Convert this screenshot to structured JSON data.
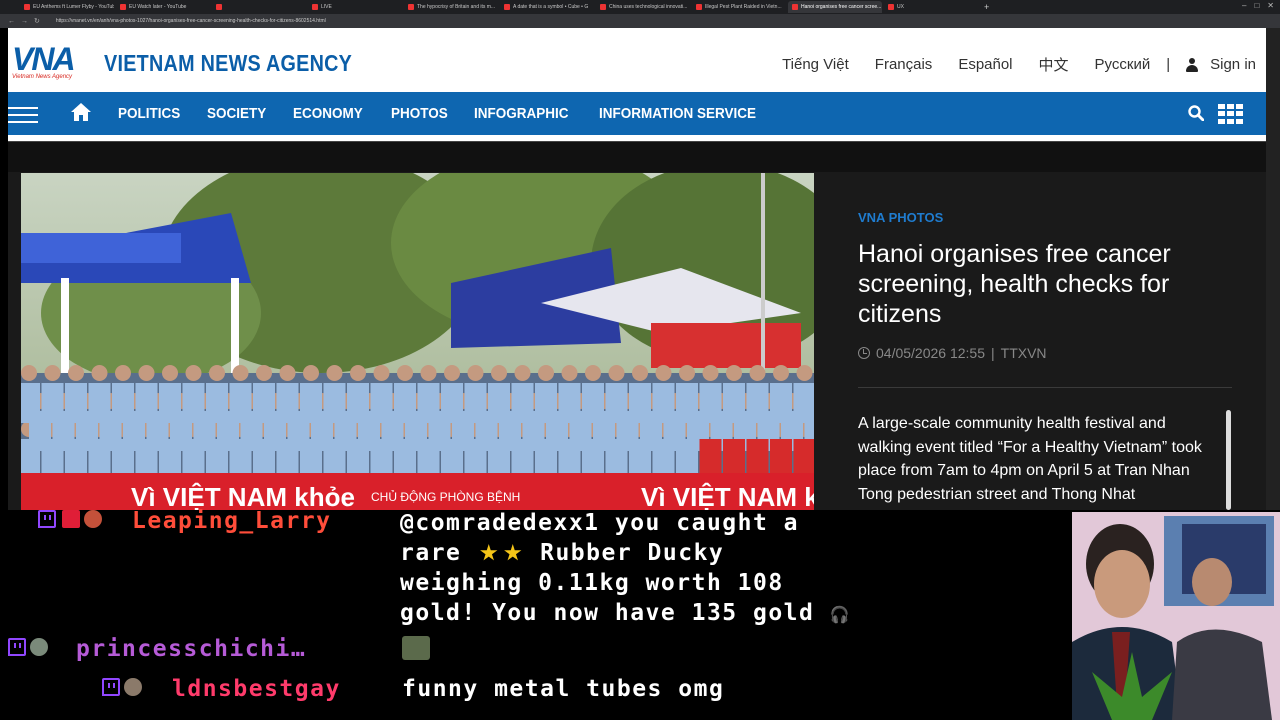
{
  "browser": {
    "tabs": [
      {
        "label": "EU Anthems ft Lumer Flyby - YouTube",
        "active": false
      },
      {
        "label": "EU Watch later - YouTube",
        "active": false
      },
      {
        "label": "",
        "active": false
      },
      {
        "label": "LIVE",
        "active": false
      },
      {
        "label": "The hypocrisy of Britain and its m...",
        "active": false
      },
      {
        "label": "A date that is a symbol • Cube • G",
        "active": false
      },
      {
        "label": "China uses technological innovati...",
        "active": false
      },
      {
        "label": "Illegal Pest Plant Raided in Vietn...",
        "active": false
      },
      {
        "label": "Hanoi organises free cancer scree...",
        "active": true
      },
      {
        "label": "UX",
        "active": false
      }
    ],
    "url": "https://vnanet.vn/en/anh/vna-photos-1027/hanoi-organises-free-cancer-screening-health-checks-for-citizens-8602514.html"
  },
  "header": {
    "logo_text": "VNA",
    "logo_sub": "Vietnam News Agency",
    "site_title": "VIETNAM NEWS AGENCY",
    "languages": [
      "Tiếng Việt",
      "Français",
      "Español",
      "中文",
      "Русский"
    ],
    "separator": "|",
    "sign_in": "Sign in"
  },
  "nav": {
    "items": [
      "POLITICS",
      "SOCIETY",
      "ECONOMY",
      "PHOTOS",
      "INFOGRAPHIC",
      "INFORMATION SERVICE"
    ]
  },
  "article": {
    "category": "VNA PHOTOS",
    "headline": "Hanoi organises free cancer screening, health checks for citizens",
    "date": "04/05/2026 12:55",
    "meta_sep": "|",
    "source": "TTXVN",
    "summary": "A large-scale community health festival and walking event titled “For a Healthy Vietnam” took place from 7am to 4pm on April 5 at Tran Nhan Tong pedestrian street and Thong Nhat",
    "photo_banner_left": "Vì VIỆT NAM khỏe",
    "photo_banner_center": "CHỦ ĐỘNG PHÒNG BỆNH",
    "photo_banner_right": "Vì VIỆT NAM khỏe"
  },
  "chat": {
    "messages": [
      {
        "user": "Leaping_Larry",
        "text_a": "@comradedexx1 you caught a",
        "text_b_pre": "rare",
        "text_b_post": "Rubber Ducky",
        "text_c": "weighing 0.11kg worth 108",
        "text_d": "gold! You now have 135 gold"
      },
      {
        "user": "princesschichi…",
        "text": ""
      },
      {
        "user": "ldnsbestgay",
        "text": "funny metal tubes omg"
      }
    ]
  },
  "colors": {
    "brand_blue": "#0e66b0",
    "brand_red": "#d7261e",
    "category_blue": "#1f7ccf",
    "chat_user1": "#ff4d3a",
    "chat_user2": "#b65bd7",
    "chat_user3": "#ff3b6b"
  }
}
